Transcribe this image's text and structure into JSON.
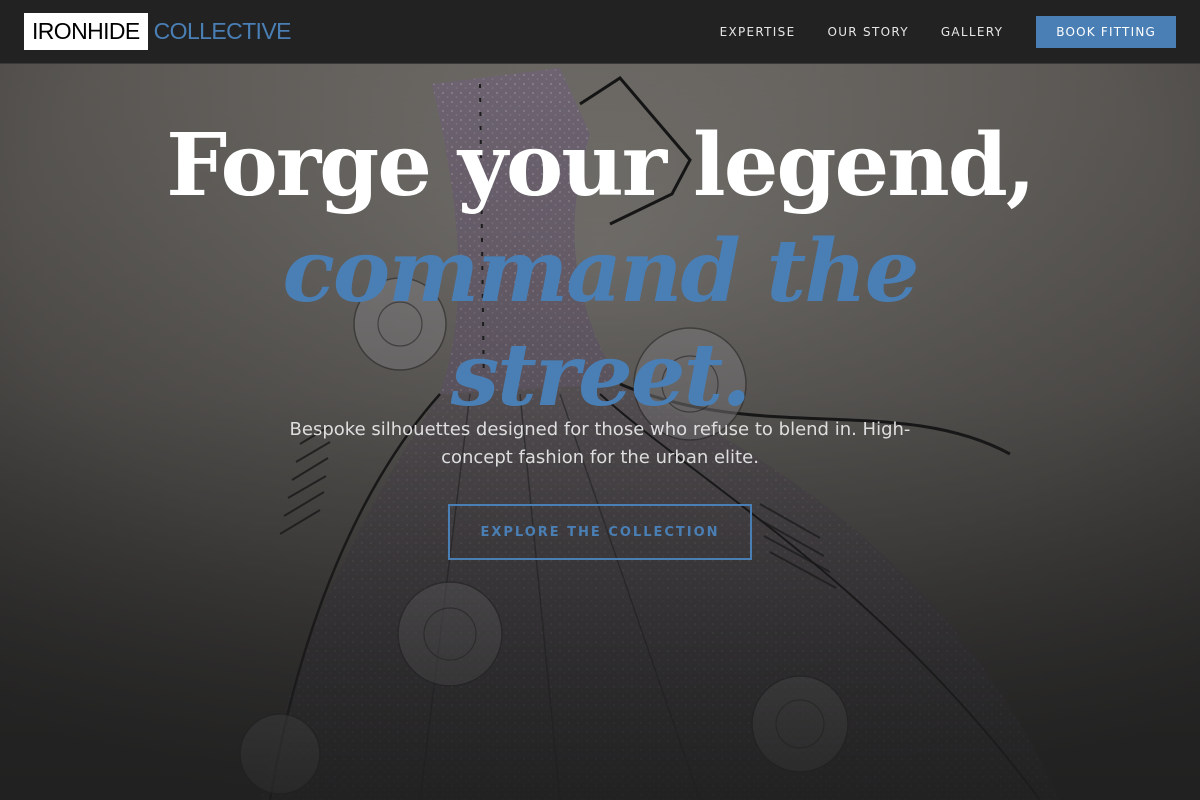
{
  "brand": {
    "name_primary": "IRONHIDE",
    "name_secondary": "COLLECTIVE"
  },
  "nav": {
    "items": [
      {
        "label": "EXPERTISE"
      },
      {
        "label": "OUR STORY"
      },
      {
        "label": "GALLERY"
      }
    ],
    "cta_label": "BOOK FITTING"
  },
  "hero": {
    "headline": "Forge your legend,",
    "accent_line_1": "command the",
    "accent_line_2": "street.",
    "subtitle": "Bespoke silhouettes designed for those who refuse to blend in. High-concept fashion for the urban elite.",
    "cta_label": "EXPLORE THE COLLECTION",
    "background_icon": "fashion-sketch-gown"
  },
  "colors": {
    "accent": "#4a7fb5",
    "header_bg": "#222222",
    "page_bg": "#1e1e1e",
    "text_primary": "#ffffff"
  }
}
